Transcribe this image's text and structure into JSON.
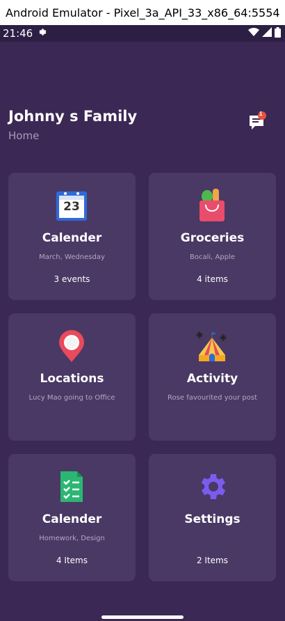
{
  "window": {
    "title": "Android Emulator - Pixel_3a_API_33_x86_64:5554"
  },
  "statusbar": {
    "time": "21:46"
  },
  "header": {
    "title": "Johnny s Family",
    "subtitle": "Home",
    "notification_count": "1"
  },
  "cards": [
    {
      "title": "Calender",
      "subtitle": "March, Wednesday",
      "count": "3 events",
      "icon": "calendar-icon",
      "icon_text": "23"
    },
    {
      "title": "Groceries",
      "subtitle": "Bocali, Apple",
      "count": "4 items",
      "icon": "grocery-bag-icon"
    },
    {
      "title": "Locations",
      "subtitle": "Lucy Mao going to Office",
      "count": "",
      "icon": "map-pin-icon"
    },
    {
      "title": "Activity",
      "subtitle": "Rose favourited your post",
      "count": "",
      "icon": "circus-tent-icon"
    },
    {
      "title": "Calender",
      "subtitle": "Homework, Design",
      "count": "4 Items",
      "icon": "checklist-icon"
    },
    {
      "title": "Settings",
      "subtitle": "",
      "count": "2 Items",
      "icon": "gear-icon"
    }
  ],
  "colors": {
    "background": "#3b2854",
    "card": "#4a3964",
    "statusbar": "#2c1f43",
    "accent_purple": "#7b5cf0",
    "checklist_green": "#2bb673",
    "pin_red": "#e94a5c"
  }
}
